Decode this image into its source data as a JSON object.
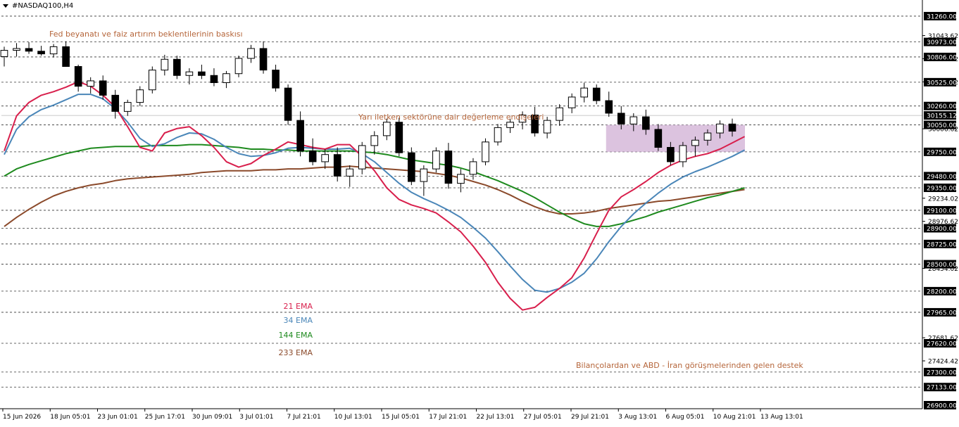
{
  "symbol": {
    "label": "#NASDAQ100,H4"
  },
  "colors": {
    "background": "#ffffff",
    "candle": "#000000",
    "grid_dashed": "#333333",
    "price_axis_box": "#000000",
    "annotation": "#b5653a",
    "ema21": "#d81f4c",
    "ema34": "#4a86b8",
    "ema144": "#1e8a1e",
    "ema233": "#8b4a2b",
    "box_fill": "#d6b8d9"
  },
  "chart_data": {
    "type": "candlestick",
    "title": "#NASDAQ100,H4",
    "ylim": [
      26900,
      31330
    ],
    "price_axis_plain_labels": [
      31043.62,
      30786.62,
      30528.62,
      30006.62,
      29234.02,
      28976.62,
      28454.02,
      27681.62,
      27424.42
    ],
    "price_axis_boxed_labels": [
      31260.0,
      30973.0,
      30806.0,
      30525.0,
      30260.0,
      30155.12,
      30050.0,
      29750.0,
      29480.0,
      29350.0,
      29100.0,
      28900.0,
      28725.0,
      28500.0,
      28200.0,
      27965.0,
      27620.0,
      27300.0,
      27133.0,
      26900.0
    ],
    "horizontal_levels": [
      31260,
      30973,
      30806,
      30525,
      30260,
      30050,
      29750,
      29480,
      29350,
      29100,
      28900,
      28725,
      28500,
      28200,
      27965,
      27620,
      27300,
      27133
    ],
    "current_price": 30155.12,
    "time_labels": [
      "15 Jun 2026",
      "18 Jun 05:01",
      "23 Jun 01:01",
      "25 Jun 17:01",
      "30 Jun 09:01",
      "3 Jul 01:01",
      "7 Jul 21:01",
      "10 Jul 13:01",
      "15 Jul 05:01",
      "17 Jul 21:01",
      "22 Jul 13:01",
      "27 Jul 05:01",
      "29 Jul 21:01",
      "3 Aug 13:01",
      "6 Aug 05:01",
      "10 Aug 21:01",
      "13 Aug 13:01"
    ],
    "consolidation_box": {
      "price_high": 30050,
      "price_low": 29750
    },
    "annotations": [
      "Fed beyanatı ve faiz artırım beklentilerinin baskısı",
      "Yarı iletken sektörüne dair değerleme endişeleri",
      "Bilançolardan ve ABD - İran görüşmelerinden gelen destek"
    ],
    "series": [
      {
        "name": "21 EMA",
        "values": [
          29760,
          30150,
          30300,
          30380,
          30420,
          30470,
          30530,
          30480,
          30380,
          30250,
          30030,
          29800,
          29760,
          29960,
          30010,
          30030,
          29930,
          29800,
          29640,
          29580,
          29620,
          29710,
          29780,
          29860,
          29830,
          29800,
          29780,
          29830,
          29830,
          29700,
          29540,
          29350,
          29220,
          29160,
          29120,
          29070,
          28970,
          28860,
          28700,
          28520,
          28300,
          28120,
          27990,
          28020,
          28130,
          28230,
          28350,
          28570,
          28840,
          29100,
          29250,
          29330,
          29420,
          29520,
          29600,
          29660,
          29700,
          29730,
          29780,
          29850,
          29920
        ]
      },
      {
        "name": "34 EMA",
        "values": [
          29720,
          30000,
          30140,
          30220,
          30270,
          30330,
          30390,
          30390,
          30340,
          30230,
          30080,
          29900,
          29810,
          29840,
          29910,
          29960,
          29950,
          29890,
          29800,
          29730,
          29700,
          29710,
          29740,
          29790,
          29800,
          29790,
          29780,
          29780,
          29790,
          29730,
          29640,
          29520,
          29400,
          29300,
          29230,
          29170,
          29100,
          29020,
          28910,
          28790,
          28640,
          28480,
          28330,
          28210,
          28190,
          28230,
          28300,
          28400,
          28560,
          28750,
          28920,
          29060,
          29180,
          29290,
          29390,
          29470,
          29530,
          29580,
          29640,
          29700,
          29770
        ]
      },
      {
        "name": "144 EMA",
        "values": [
          29480,
          29560,
          29610,
          29650,
          29690,
          29730,
          29760,
          29790,
          29800,
          29810,
          29810,
          29810,
          29820,
          29820,
          29820,
          29830,
          29830,
          29820,
          29810,
          29800,
          29780,
          29780,
          29770,
          29770,
          29760,
          29760,
          29760,
          29760,
          29760,
          29750,
          29740,
          29720,
          29690,
          29660,
          29640,
          29620,
          29600,
          29570,
          29530,
          29480,
          29430,
          29370,
          29310,
          29240,
          29160,
          29080,
          29010,
          28950,
          28920,
          28920,
          28950,
          28990,
          29030,
          29080,
          29120,
          29160,
          29200,
          29240,
          29270,
          29310,
          29350
        ]
      },
      {
        "name": "233 EMA",
        "values": [
          28920,
          29020,
          29110,
          29190,
          29260,
          29310,
          29350,
          29380,
          29400,
          29430,
          29450,
          29460,
          29470,
          29480,
          29490,
          29500,
          29520,
          29530,
          29540,
          29540,
          29540,
          29550,
          29550,
          29560,
          29560,
          29570,
          29580,
          29580,
          29590,
          29580,
          29570,
          29560,
          29550,
          29540,
          29530,
          29510,
          29490,
          29460,
          29420,
          29380,
          29330,
          29270,
          29200,
          29140,
          29090,
          29060,
          29060,
          29070,
          29090,
          29120,
          29140,
          29160,
          29180,
          29200,
          29210,
          29230,
          29250,
          29270,
          29290,
          29310,
          29330
        ]
      }
    ],
    "candles": [
      [
        30810,
        30920,
        30700,
        30880
      ],
      [
        30880,
        30960,
        30810,
        30900
      ],
      [
        30900,
        30970,
        30840,
        30870
      ],
      [
        30870,
        30930,
        30820,
        30840
      ],
      [
        30840,
        30950,
        30800,
        30920
      ],
      [
        30920,
        30980,
        30860,
        30700
      ],
      [
        30700,
        30720,
        30420,
        30480
      ],
      [
        30480,
        30580,
        30400,
        30540
      ],
      [
        30540,
        30600,
        30330,
        30380
      ],
      [
        30380,
        30440,
        30120,
        30200
      ],
      [
        30200,
        30330,
        30150,
        30300
      ],
      [
        30300,
        30480,
        30260,
        30440
      ],
      [
        30440,
        30700,
        30400,
        30660
      ],
      [
        30660,
        30830,
        30600,
        30780
      ],
      [
        30780,
        30820,
        30560,
        30600
      ],
      [
        30600,
        30680,
        30500,
        30640
      ],
      [
        30640,
        30720,
        30560,
        30600
      ],
      [
        30600,
        30680,
        30480,
        30520
      ],
      [
        30520,
        30650,
        30460,
        30620
      ],
      [
        30620,
        30820,
        30580,
        30790
      ],
      [
        30790,
        30940,
        30740,
        30900
      ],
      [
        30900,
        30980,
        30620,
        30660
      ],
      [
        30660,
        30720,
        30420,
        30460
      ],
      [
        30460,
        30500,
        30050,
        30100
      ],
      [
        30100,
        30200,
        29700,
        29760
      ],
      [
        29760,
        29900,
        29600,
        29640
      ],
      [
        29640,
        29780,
        29560,
        29720
      ],
      [
        29720,
        29800,
        29420,
        29480
      ],
      [
        29480,
        29600,
        29360,
        29560
      ],
      [
        29560,
        29860,
        29500,
        29820
      ],
      [
        29820,
        29980,
        29720,
        29930
      ],
      [
        29930,
        30120,
        29880,
        30080
      ],
      [
        30080,
        30130,
        29700,
        29740
      ],
      [
        29740,
        29800,
        29380,
        29420
      ],
      [
        29420,
        29600,
        29260,
        29560
      ],
      [
        29560,
        29800,
        29520,
        29760
      ],
      [
        29760,
        29850,
        29340,
        29400
      ],
      [
        29400,
        29560,
        29300,
        29500
      ],
      [
        29500,
        29680,
        29440,
        29640
      ],
      [
        29640,
        29900,
        29600,
        29860
      ],
      [
        29860,
        30060,
        29820,
        30020
      ],
      [
        30020,
        30120,
        29960,
        30080
      ],
      [
        30080,
        30200,
        30000,
        30160
      ],
      [
        30160,
        30250,
        29920,
        29960
      ],
      [
        29960,
        30140,
        29900,
        30100
      ],
      [
        30100,
        30280,
        30040,
        30240
      ],
      [
        30240,
        30400,
        30180,
        30360
      ],
      [
        30360,
        30520,
        30300,
        30460
      ],
      [
        30460,
        30500,
        30280,
        30320
      ],
      [
        30320,
        30420,
        30140,
        30180
      ],
      [
        30180,
        30260,
        30000,
        30060
      ],
      [
        30060,
        30180,
        29980,
        30140
      ],
      [
        30140,
        30220,
        29940,
        30000
      ],
      [
        30000,
        30060,
        29760,
        29800
      ],
      [
        29800,
        29860,
        29600,
        29640
      ],
      [
        29640,
        29860,
        29580,
        29820
      ],
      [
        29820,
        29920,
        29700,
        29880
      ],
      [
        29880,
        30000,
        29820,
        29960
      ],
      [
        29960,
        30100,
        29900,
        30060
      ],
      [
        30060,
        30120,
        29920,
        29980
      ]
    ]
  }
}
